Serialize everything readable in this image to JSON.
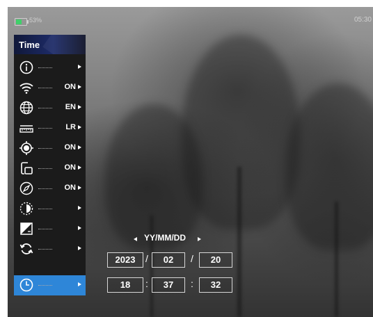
{
  "status": {
    "battery_label": "53%",
    "battery_level": 0.55,
    "battery_color": "#3fd06a",
    "time": "05:30"
  },
  "sidebar": {
    "title": "Time",
    "accent": "#2e86d8",
    "items": [
      {
        "icon": "info-icon",
        "value": ""
      },
      {
        "icon": "wifi-icon",
        "value": "ON"
      },
      {
        "icon": "globe-icon",
        "value": "EN"
      },
      {
        "icon": "ruler-icon",
        "value": "LR"
      },
      {
        "icon": "target-icon",
        "value": "ON"
      },
      {
        "icon": "screen-rotate-icon",
        "value": "ON"
      },
      {
        "icon": "compass-icon",
        "value": "ON"
      },
      {
        "icon": "half-circle-icon",
        "value": ""
      },
      {
        "icon": "contrast-icon",
        "value": ""
      },
      {
        "icon": "refresh-icon",
        "value": ""
      },
      {
        "icon": "clock-icon",
        "value": ""
      }
    ]
  },
  "time_settings": {
    "format_label": "YY/MM/DD",
    "date": {
      "year": "2023",
      "month": "02",
      "day": "20",
      "separator": "/"
    },
    "time": {
      "hour": "18",
      "minute": "37",
      "second": "32",
      "separator": ":"
    }
  }
}
